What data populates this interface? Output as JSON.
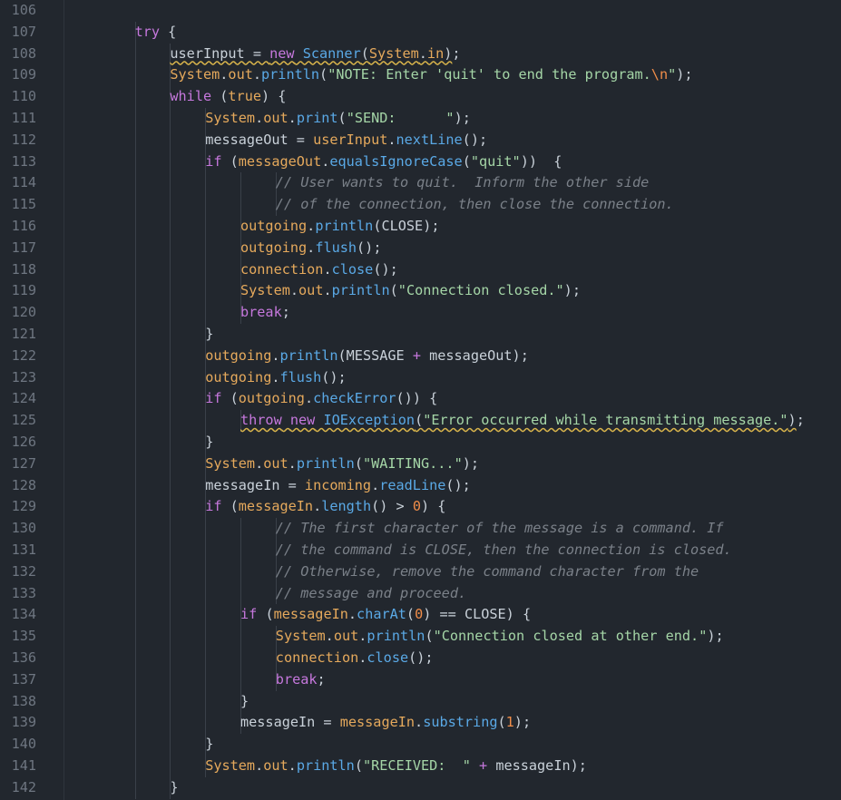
{
  "editor": {
    "lines": [
      {
        "num": "106",
        "indent": 0,
        "tokens": []
      },
      {
        "num": "107",
        "indent": 2,
        "tokens": [
          [
            "kw",
            "try"
          ],
          [
            "p",
            " {"
          ]
        ]
      },
      {
        "num": "108",
        "indent": 3,
        "tokens": [
          [
            "sqp",
            "userInput = "
          ],
          [
            "sqkw",
            "new"
          ],
          [
            "sqp",
            " "
          ],
          [
            "sqf",
            "Scanner"
          ],
          [
            "sqp",
            "("
          ],
          [
            "sqt",
            "System"
          ],
          [
            "sqp",
            "."
          ],
          [
            "sqt",
            "in"
          ],
          [
            "sqp",
            ")"
          ],
          [
            "p",
            ";"
          ]
        ]
      },
      {
        "num": "109",
        "indent": 3,
        "tokens": [
          [
            "t",
            "System"
          ],
          [
            "p",
            "."
          ],
          [
            "t",
            "out"
          ],
          [
            "p",
            "."
          ],
          [
            "f",
            "println"
          ],
          [
            "p",
            "("
          ],
          [
            "s",
            "\"NOTE: Enter 'quit' to end the program."
          ],
          [
            "n",
            "\\n"
          ],
          [
            "s",
            "\""
          ],
          [
            "p",
            ");"
          ]
        ]
      },
      {
        "num": "110",
        "indent": 3,
        "tokens": [
          [
            "kw",
            "while"
          ],
          [
            "p",
            " ("
          ],
          [
            "t",
            "true"
          ],
          [
            "p",
            ") {"
          ]
        ]
      },
      {
        "num": "111",
        "indent": 4,
        "tokens": [
          [
            "t",
            "System"
          ],
          [
            "p",
            "."
          ],
          [
            "t",
            "out"
          ],
          [
            "p",
            "."
          ],
          [
            "f",
            "print"
          ],
          [
            "p",
            "("
          ],
          [
            "s",
            "\"SEND:      \""
          ],
          [
            "p",
            ");"
          ]
        ]
      },
      {
        "num": "112",
        "indent": 4,
        "tokens": [
          [
            "p",
            "messageOut = "
          ],
          [
            "t",
            "userInput"
          ],
          [
            "p",
            "."
          ],
          [
            "f",
            "nextLine"
          ],
          [
            "p",
            "();"
          ]
        ]
      },
      {
        "num": "113",
        "indent": 4,
        "tokens": [
          [
            "kw",
            "if"
          ],
          [
            "p",
            " ("
          ],
          [
            "t",
            "messageOut"
          ],
          [
            "p",
            "."
          ],
          [
            "f",
            "equalsIgnoreCase"
          ],
          [
            "p",
            "("
          ],
          [
            "s",
            "\"quit\""
          ],
          [
            "p",
            "))  {"
          ]
        ]
      },
      {
        "num": "114",
        "indent": 6,
        "tokens": [
          [
            "c",
            "// User wants to quit.  Inform the other side"
          ]
        ]
      },
      {
        "num": "115",
        "indent": 6,
        "tokens": [
          [
            "c",
            "// of the connection, then close the connection."
          ]
        ]
      },
      {
        "num": "116",
        "indent": 5,
        "tokens": [
          [
            "t",
            "outgoing"
          ],
          [
            "p",
            "."
          ],
          [
            "f",
            "println"
          ],
          [
            "p",
            "(CLOSE);"
          ]
        ]
      },
      {
        "num": "117",
        "indent": 5,
        "tokens": [
          [
            "t",
            "outgoing"
          ],
          [
            "p",
            "."
          ],
          [
            "f",
            "flush"
          ],
          [
            "p",
            "();"
          ]
        ]
      },
      {
        "num": "118",
        "indent": 5,
        "tokens": [
          [
            "t",
            "connection"
          ],
          [
            "p",
            "."
          ],
          [
            "f",
            "close"
          ],
          [
            "p",
            "();"
          ]
        ]
      },
      {
        "num": "119",
        "indent": 5,
        "tokens": [
          [
            "t",
            "System"
          ],
          [
            "p",
            "."
          ],
          [
            "t",
            "out"
          ],
          [
            "p",
            "."
          ],
          [
            "f",
            "println"
          ],
          [
            "p",
            "("
          ],
          [
            "s",
            "\"Connection closed.\""
          ],
          [
            "p",
            ");"
          ]
        ]
      },
      {
        "num": "120",
        "indent": 5,
        "tokens": [
          [
            "kw",
            "break"
          ],
          [
            "p",
            ";"
          ]
        ]
      },
      {
        "num": "121",
        "indent": 4,
        "tokens": [
          [
            "p",
            "}"
          ]
        ]
      },
      {
        "num": "122",
        "indent": 4,
        "tokens": [
          [
            "t",
            "outgoing"
          ],
          [
            "p",
            "."
          ],
          [
            "f",
            "println"
          ],
          [
            "p",
            "(MESSAGE "
          ],
          [
            "kw",
            "+"
          ],
          [
            "p",
            " messageOut);"
          ]
        ]
      },
      {
        "num": "123",
        "indent": 4,
        "tokens": [
          [
            "t",
            "outgoing"
          ],
          [
            "p",
            "."
          ],
          [
            "f",
            "flush"
          ],
          [
            "p",
            "();"
          ]
        ]
      },
      {
        "num": "124",
        "indent": 4,
        "tokens": [
          [
            "kw",
            "if"
          ],
          [
            "p",
            " ("
          ],
          [
            "t",
            "outgoing"
          ],
          [
            "p",
            "."
          ],
          [
            "f",
            "checkError"
          ],
          [
            "p",
            "()) {"
          ]
        ]
      },
      {
        "num": "125",
        "indent": 5,
        "tokens": [
          [
            "sqkw",
            "throw"
          ],
          [
            "sqp",
            " "
          ],
          [
            "sqkw",
            "new"
          ],
          [
            "sqp",
            " "
          ],
          [
            "sqf",
            "IOException"
          ],
          [
            "sqp",
            "("
          ],
          [
            "sqs",
            "\"Error occurred while transmitting message.\""
          ],
          [
            "sqp",
            ")"
          ],
          [
            "p",
            ";"
          ]
        ]
      },
      {
        "num": "126",
        "indent": 4,
        "tokens": [
          [
            "p",
            "}"
          ]
        ]
      },
      {
        "num": "127",
        "indent": 4,
        "tokens": [
          [
            "t",
            "System"
          ],
          [
            "p",
            "."
          ],
          [
            "t",
            "out"
          ],
          [
            "p",
            "."
          ],
          [
            "f",
            "println"
          ],
          [
            "p",
            "("
          ],
          [
            "s",
            "\"WAITING...\""
          ],
          [
            "p",
            ");"
          ]
        ]
      },
      {
        "num": "128",
        "indent": 4,
        "tokens": [
          [
            "p",
            "messageIn = "
          ],
          [
            "t",
            "incoming"
          ],
          [
            "p",
            "."
          ],
          [
            "f",
            "readLine"
          ],
          [
            "p",
            "();"
          ]
        ]
      },
      {
        "num": "129",
        "indent": 4,
        "tokens": [
          [
            "kw",
            "if"
          ],
          [
            "p",
            " ("
          ],
          [
            "t",
            "messageIn"
          ],
          [
            "p",
            "."
          ],
          [
            "f",
            "length"
          ],
          [
            "p",
            "() > "
          ],
          [
            "n",
            "0"
          ],
          [
            "p",
            ") {"
          ]
        ]
      },
      {
        "num": "130",
        "indent": 6,
        "tokens": [
          [
            "c",
            "// The first character of the message is a command. If"
          ]
        ]
      },
      {
        "num": "131",
        "indent": 6,
        "tokens": [
          [
            "c",
            "// the command is CLOSE, then the connection is closed."
          ]
        ]
      },
      {
        "num": "132",
        "indent": 6,
        "tokens": [
          [
            "c",
            "// Otherwise, remove the command character from the"
          ]
        ]
      },
      {
        "num": "133",
        "indent": 6,
        "tokens": [
          [
            "c",
            "// message and proceed."
          ]
        ]
      },
      {
        "num": "134",
        "indent": 5,
        "tokens": [
          [
            "kw",
            "if"
          ],
          [
            "p",
            " ("
          ],
          [
            "t",
            "messageIn"
          ],
          [
            "p",
            "."
          ],
          [
            "f",
            "charAt"
          ],
          [
            "p",
            "("
          ],
          [
            "n",
            "0"
          ],
          [
            "p",
            ") == CLOSE) {"
          ]
        ]
      },
      {
        "num": "135",
        "indent": 6,
        "tokens": [
          [
            "t",
            "System"
          ],
          [
            "p",
            "."
          ],
          [
            "t",
            "out"
          ],
          [
            "p",
            "."
          ],
          [
            "f",
            "println"
          ],
          [
            "p",
            "("
          ],
          [
            "s",
            "\"Connection closed at other end.\""
          ],
          [
            "p",
            ");"
          ]
        ]
      },
      {
        "num": "136",
        "indent": 6,
        "tokens": [
          [
            "t",
            "connection"
          ],
          [
            "p",
            "."
          ],
          [
            "f",
            "close"
          ],
          [
            "p",
            "();"
          ]
        ]
      },
      {
        "num": "137",
        "indent": 6,
        "tokens": [
          [
            "kw",
            "break"
          ],
          [
            "p",
            ";"
          ]
        ]
      },
      {
        "num": "138",
        "indent": 5,
        "tokens": [
          [
            "p",
            "}"
          ]
        ]
      },
      {
        "num": "139",
        "indent": 5,
        "tokens": [
          [
            "p",
            "messageIn = "
          ],
          [
            "t",
            "messageIn"
          ],
          [
            "p",
            "."
          ],
          [
            "f",
            "substring"
          ],
          [
            "p",
            "("
          ],
          [
            "n",
            "1"
          ],
          [
            "p",
            ");"
          ]
        ]
      },
      {
        "num": "140",
        "indent": 4,
        "tokens": [
          [
            "p",
            "}"
          ]
        ]
      },
      {
        "num": "141",
        "indent": 4,
        "tokens": [
          [
            "t",
            "System"
          ],
          [
            "p",
            "."
          ],
          [
            "t",
            "out"
          ],
          [
            "p",
            "."
          ],
          [
            "f",
            "println"
          ],
          [
            "p",
            "("
          ],
          [
            "s",
            "\"RECEIVED:  \""
          ],
          [
            "p",
            " "
          ],
          [
            "kw",
            "+"
          ],
          [
            "p",
            " messageIn);"
          ]
        ]
      },
      {
        "num": "142",
        "indent": 3,
        "tokens": [
          [
            "p",
            "}"
          ]
        ]
      }
    ]
  }
}
